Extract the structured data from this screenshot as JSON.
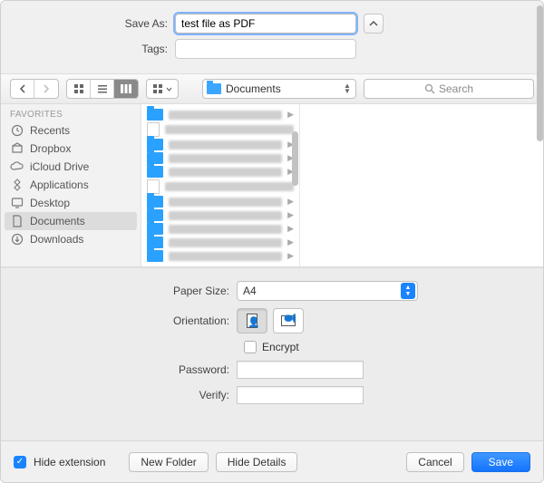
{
  "header": {
    "save_as_label": "Save As:",
    "save_as_value": "test file as PDF",
    "tags_label": "Tags:",
    "tags_value": ""
  },
  "toolbar": {
    "location": "Documents",
    "search_placeholder": "Search"
  },
  "sidebar": {
    "header": "Favorites",
    "items": [
      {
        "label": "Recents",
        "icon": "clock"
      },
      {
        "label": "Dropbox",
        "icon": "box"
      },
      {
        "label": "iCloud Drive",
        "icon": "cloud"
      },
      {
        "label": "Applications",
        "icon": "apps"
      },
      {
        "label": "Desktop",
        "icon": "desktop"
      },
      {
        "label": "Documents",
        "icon": "document",
        "selected": true
      },
      {
        "label": "Downloads",
        "icon": "download"
      }
    ]
  },
  "column_entries": [
    {
      "type": "folder",
      "arrow": true
    },
    {
      "type": "file",
      "arrow": false
    },
    {
      "type": "folder",
      "arrow": true
    },
    {
      "type": "folder",
      "arrow": true
    },
    {
      "type": "folder",
      "arrow": true
    },
    {
      "type": "file",
      "arrow": false
    },
    {
      "type": "folder",
      "arrow": true
    },
    {
      "type": "folder",
      "arrow": true
    },
    {
      "type": "folder",
      "arrow": true
    },
    {
      "type": "folder",
      "arrow": true
    },
    {
      "type": "folder",
      "arrow": true
    }
  ],
  "options": {
    "paper_size_label": "Paper Size:",
    "paper_size_value": "A4",
    "orientation_label": "Orientation:",
    "encrypt_label": "Encrypt",
    "encrypt_checked": false,
    "password_label": "Password:",
    "verify_label": "Verify:"
  },
  "footer": {
    "hide_ext_label": "Hide extension",
    "hide_ext_checked": true,
    "new_folder": "New Folder",
    "hide_details": "Hide Details",
    "cancel": "Cancel",
    "save": "Save"
  }
}
